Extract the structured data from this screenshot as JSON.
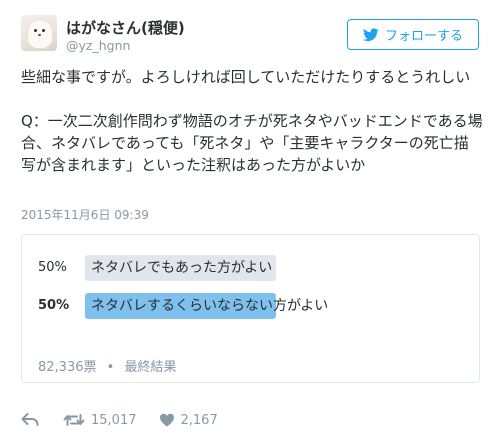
{
  "user": {
    "name": "はがなさん(穏便)",
    "handle": "@yz_hgnn"
  },
  "follow_button": {
    "label": "フォローする"
  },
  "tweet": {
    "line1": "些細な事ですが。よろしければ回していただけたりするとうれしい",
    "line2": "Q：一次二次創作問わず物語のオチが死ネタやバッドエンドである場合、ネタバレであっても「死ネタ」や「主要キャラクターの死亡描写が含まれます」といった注釈はあった方がよいか"
  },
  "timestamp": "2015年11月6日 09:39",
  "poll": {
    "options": [
      {
        "percent_text": "50%",
        "label": "ネタバレでもあった方がよい",
        "value": 0.5,
        "winner": false
      },
      {
        "percent_text": "50%",
        "label": "ネタバレするくらいならない方がよい",
        "value": 0.5,
        "winner": true
      }
    ],
    "votes": "82,336票",
    "separator": "•",
    "status": "最終結果"
  },
  "actions": {
    "retweet_count": "15,017",
    "like_count": "2,167"
  },
  "colors": {
    "accent": "#1da1f2",
    "bar_loser": "#dfe6ec",
    "bar_winner": "#7ec1ef",
    "muted": "#8899a6"
  }
}
